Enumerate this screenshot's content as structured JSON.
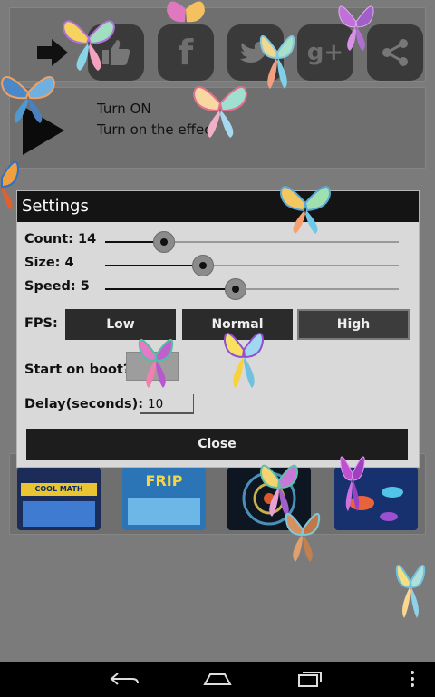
{
  "share": {
    "items": [
      "share-exit-icon",
      "thumbs-up-icon",
      "facebook-icon",
      "twitter-icon",
      "google-plus-icon",
      "share-icon"
    ]
  },
  "turn": {
    "title": "Turn ON",
    "subtitle": "Turn on the effec"
  },
  "apps": [
    {
      "name": "COOL MATH GAMES"
    },
    {
      "name": "FRIP"
    },
    {
      "name": ""
    },
    {
      "name": ""
    }
  ],
  "dialog": {
    "title": "Settings",
    "count_label": "Count: 14",
    "count_value": 14,
    "size_label": "Size: 4",
    "size_value": 4,
    "speed_label": "Speed: 5",
    "speed_value": 5,
    "fps_label": "FPS:",
    "fps_options": [
      "Low",
      "Normal",
      "High"
    ],
    "fps_selected": "High",
    "boot_label": "Start on boot?",
    "delay_label": "Delay(seconds):",
    "delay_value": "10",
    "close_label": "Close"
  },
  "colors": {
    "dialog_bg": "#d9d9d9",
    "title_bar": "#141414",
    "button": "#2b2b2b"
  },
  "navbar": {
    "items": [
      "back-icon",
      "home-icon",
      "recents-icon",
      "menu-icon"
    ]
  }
}
